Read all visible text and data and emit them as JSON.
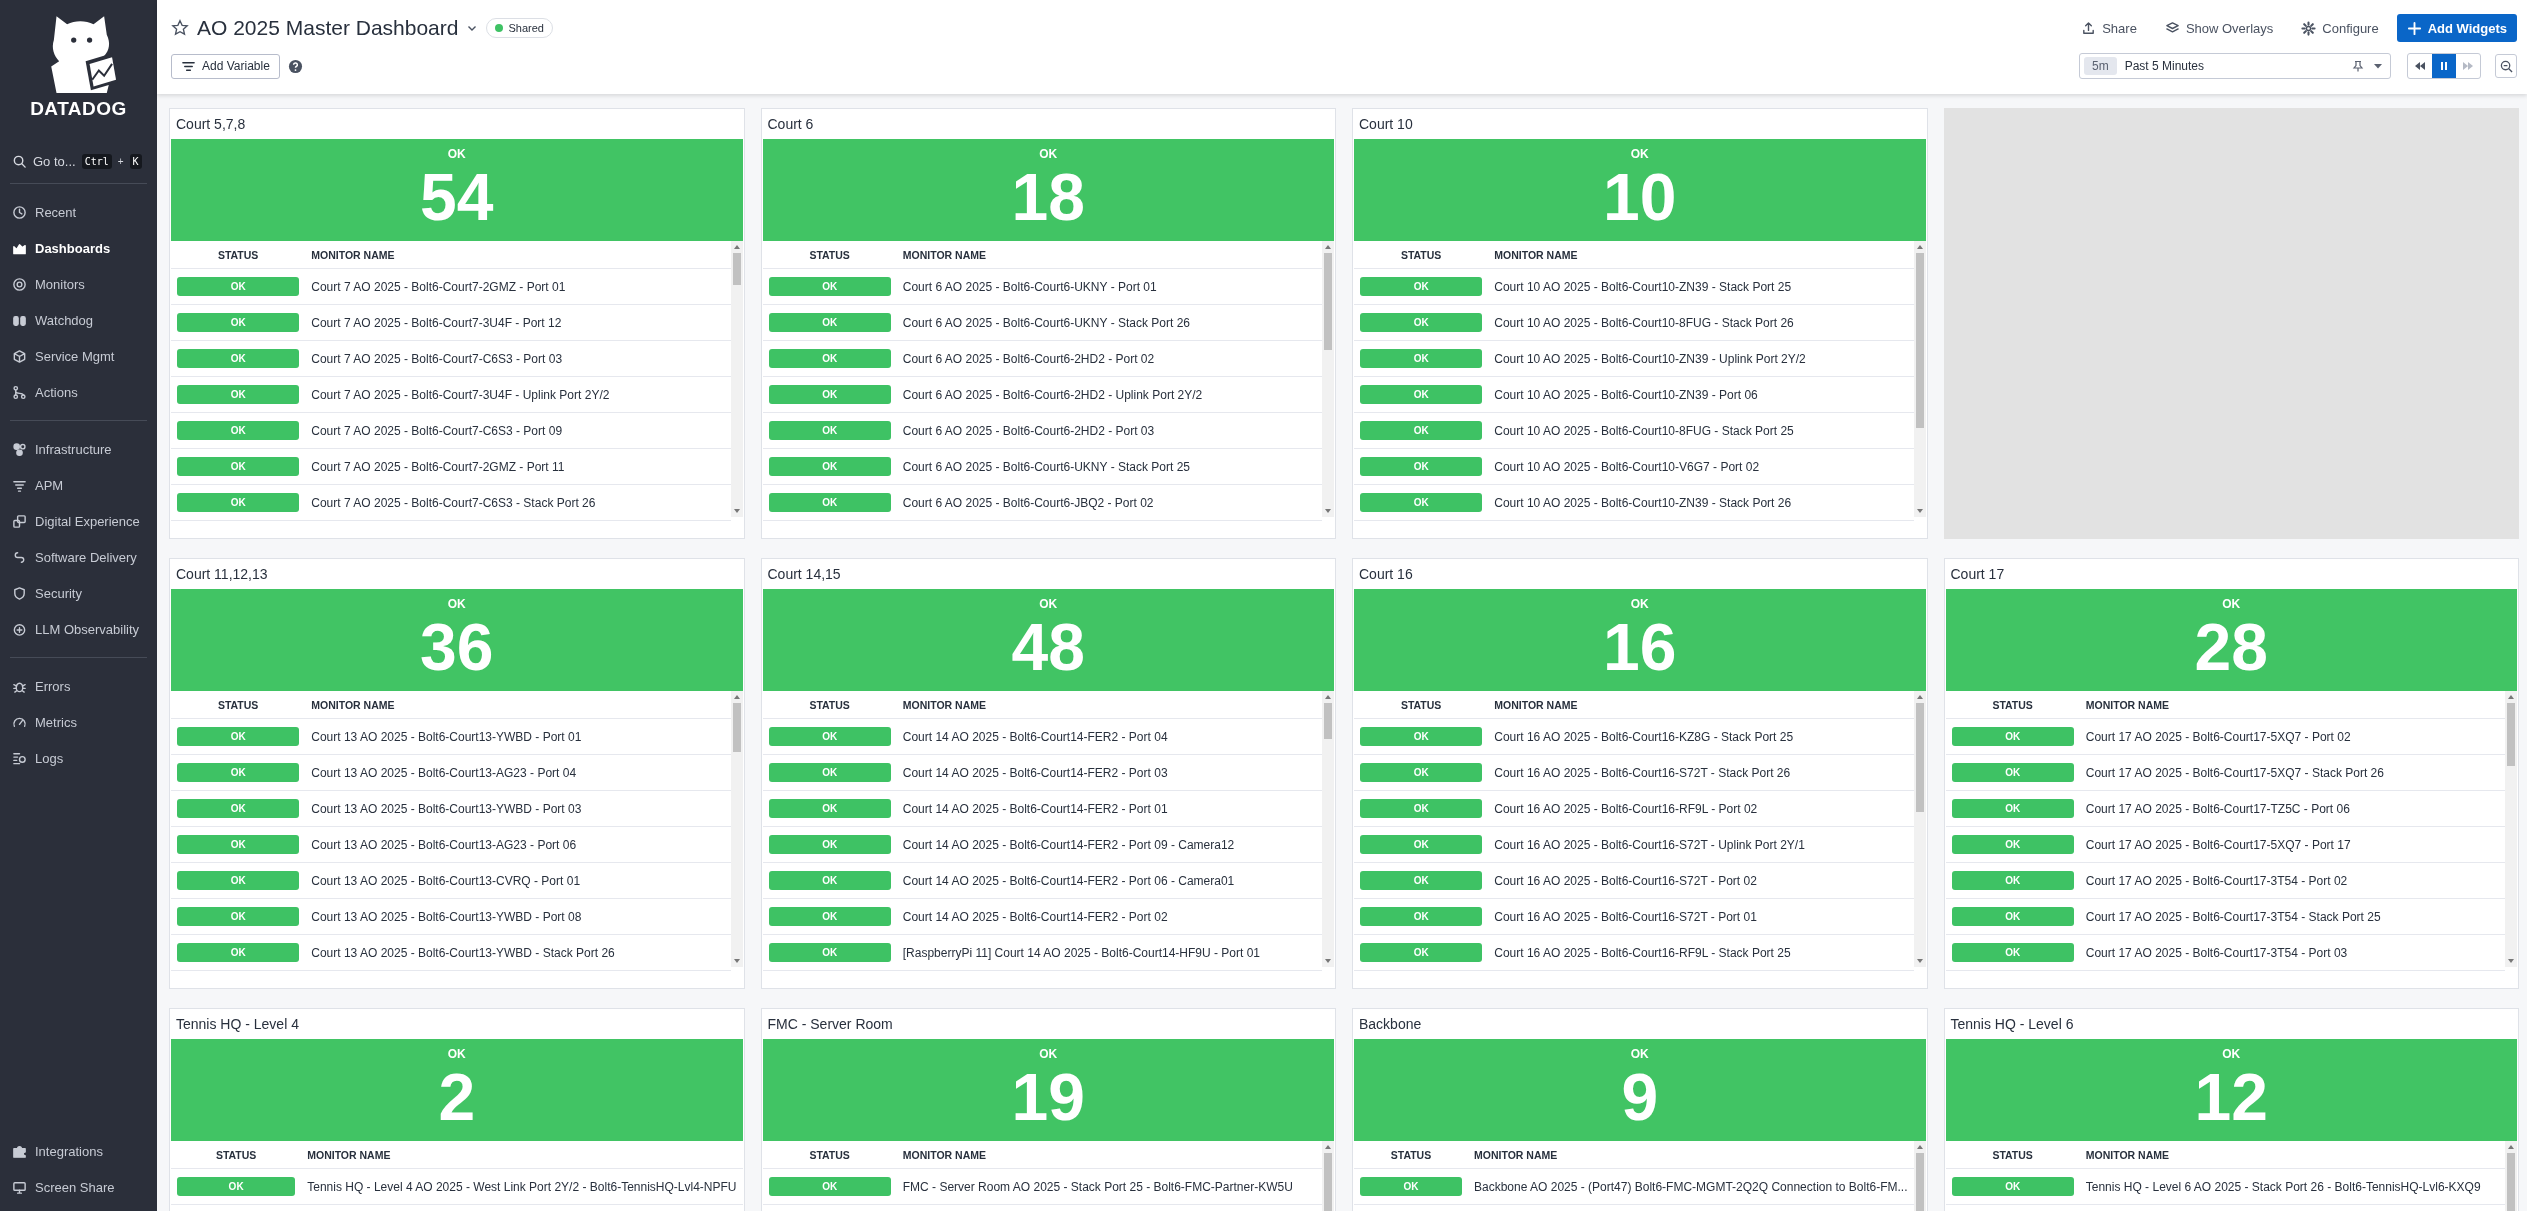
{
  "sidebar": {
    "logo_text": "DATADOG",
    "search": {
      "label": "Go to...",
      "keys": [
        "Ctrl",
        "+",
        "K"
      ]
    },
    "sections": [
      {
        "items": [
          {
            "label": "Recent",
            "selected": false
          },
          {
            "label": "Dashboards",
            "selected": true
          },
          {
            "label": "Monitors",
            "selected": false
          },
          {
            "label": "Watchdog",
            "selected": false
          },
          {
            "label": "Service Mgmt",
            "selected": false
          },
          {
            "label": "Actions",
            "selected": false
          }
        ]
      },
      {
        "items": [
          {
            "label": "Infrastructure",
            "selected": false
          },
          {
            "label": "APM",
            "selected": false
          },
          {
            "label": "Digital Experience",
            "selected": false
          },
          {
            "label": "Software Delivery",
            "selected": false
          },
          {
            "label": "Security",
            "selected": false
          },
          {
            "label": "LLM Observability",
            "selected": false
          }
        ]
      },
      {
        "items": [
          {
            "label": "Errors",
            "selected": false
          },
          {
            "label": "Metrics",
            "selected": false
          },
          {
            "label": "Logs",
            "selected": false
          }
        ]
      }
    ],
    "bottom_items": [
      {
        "label": "Integrations",
        "selected": false
      },
      {
        "label": "Screen Share",
        "selected": false
      }
    ]
  },
  "header": {
    "title": "AO 2025 Master Dashboard",
    "badge": "Shared",
    "add_variable": "Add Variable",
    "actions": [
      {
        "label": "Share",
        "kind": "plain"
      },
      {
        "label": "Show Overlays",
        "kind": "plain"
      },
      {
        "label": "Configure",
        "kind": "plain"
      },
      {
        "label": "Add Widgets",
        "kind": "primary"
      }
    ],
    "timeframe": {
      "short": "5m",
      "label": "Past 5 Minutes"
    }
  },
  "widgets": [
    {
      "kind": "monitor-summary",
      "title": "Court 5,7,8",
      "status": "OK",
      "count": "54",
      "scrollable": true,
      "columns": [
        "STATUS",
        "MONITOR NAME"
      ],
      "rows": [
        {
          "status": "OK",
          "name": "Court 7 AO 2025 - Bolt6-Court7-2GMZ - Port 01"
        },
        {
          "status": "OK",
          "name": "Court 7 AO 2025 - Bolt6-Court7-3U4F - Port 12"
        },
        {
          "status": "OK",
          "name": "Court 7 AO 2025 - Bolt6-Court7-C6S3 - Port 03"
        },
        {
          "status": "OK",
          "name": "Court 7 AO 2025 - Bolt6-Court7-3U4F - Uplink Port 2Y/2"
        },
        {
          "status": "OK",
          "name": "Court 7 AO 2025 - Bolt6-Court7-C6S3 - Port 09"
        },
        {
          "status": "OK",
          "name": "Court 7 AO 2025 - Bolt6-Court7-2GMZ - Port 11"
        },
        {
          "status": "OK",
          "name": "Court 7 AO 2025 - Bolt6-Court7-C6S3 - Stack Port 26"
        }
      ]
    },
    {
      "kind": "monitor-summary",
      "title": "Court 6",
      "status": "OK",
      "count": "18",
      "scrollable": true,
      "columns": [
        "STATUS",
        "MONITOR NAME"
      ],
      "rows": [
        {
          "status": "OK",
          "name": "Court 6 AO 2025 - Bolt6-Court6-UKNY - Port 01"
        },
        {
          "status": "OK",
          "name": "Court 6 AO 2025 - Bolt6-Court6-UKNY - Stack Port 26"
        },
        {
          "status": "OK",
          "name": "Court 6 AO 2025 - Bolt6-Court6-2HD2 - Port 02"
        },
        {
          "status": "OK",
          "name": "Court 6 AO 2025 - Bolt6-Court6-2HD2 - Uplink Port 2Y/2"
        },
        {
          "status": "OK",
          "name": "Court 6 AO 2025 - Bolt6-Court6-2HD2 - Port 03"
        },
        {
          "status": "OK",
          "name": "Court 6 AO 2025 - Bolt6-Court6-UKNY - Stack Port 25"
        },
        {
          "status": "OK",
          "name": "Court 6 AO 2025 - Bolt6-Court6-JBQ2 - Port 02"
        }
      ]
    },
    {
      "kind": "monitor-summary",
      "title": "Court 10",
      "status": "OK",
      "count": "10",
      "scrollable": true,
      "columns": [
        "STATUS",
        "MONITOR NAME"
      ],
      "rows": [
        {
          "status": "OK",
          "name": "Court 10 AO 2025 - Bolt6-Court10-ZN39 - Stack Port 25"
        },
        {
          "status": "OK",
          "name": "Court 10 AO 2025 - Bolt6-Court10-8FUG - Stack Port 26"
        },
        {
          "status": "OK",
          "name": "Court 10 AO 2025 - Bolt6-Court10-ZN39 - Uplink Port 2Y/2"
        },
        {
          "status": "OK",
          "name": "Court 10 AO 2025 - Bolt6-Court10-ZN39 - Port 06"
        },
        {
          "status": "OK",
          "name": "Court 10 AO 2025 - Bolt6-Court10-8FUG - Stack Port 25"
        },
        {
          "status": "OK",
          "name": "Court 10 AO 2025 - Bolt6-Court10-V6G7 - Port 02"
        },
        {
          "status": "OK",
          "name": "Court 10 AO 2025 - Bolt6-Court10-ZN39 - Stack Port 26"
        }
      ]
    },
    {
      "kind": "placeholder"
    },
    {
      "kind": "monitor-summary",
      "title": "Court 11,12,13",
      "status": "OK",
      "count": "36",
      "scrollable": true,
      "columns": [
        "STATUS",
        "MONITOR NAME"
      ],
      "rows": [
        {
          "status": "OK",
          "name": "Court 13 AO 2025 - Bolt6-Court13-YWBD - Port 01"
        },
        {
          "status": "OK",
          "name": "Court 13 AO 2025 - Bolt6-Court13-AG23 - Port 04"
        },
        {
          "status": "OK",
          "name": "Court 13 AO 2025 - Bolt6-Court13-YWBD - Port 03"
        },
        {
          "status": "OK",
          "name": "Court 13 AO 2025 - Bolt6-Court13-AG23 - Port 06"
        },
        {
          "status": "OK",
          "name": "Court 13 AO 2025 - Bolt6-Court13-CVRQ - Port 01"
        },
        {
          "status": "OK",
          "name": "Court 13 AO 2025 - Bolt6-Court13-YWBD - Port 08"
        },
        {
          "status": "OK",
          "name": "Court 13 AO 2025 - Bolt6-Court13-YWBD - Stack Port 26"
        }
      ]
    },
    {
      "kind": "monitor-summary",
      "title": "Court 14,15",
      "status": "OK",
      "count": "48",
      "scrollable": true,
      "columns": [
        "STATUS",
        "MONITOR NAME"
      ],
      "rows": [
        {
          "status": "OK",
          "name": "Court 14 AO 2025 - Bolt6-Court14-FER2 - Port 04"
        },
        {
          "status": "OK",
          "name": "Court 14 AO 2025 - Bolt6-Court14-FER2 - Port 03"
        },
        {
          "status": "OK",
          "name": "Court 14 AO 2025 - Bolt6-Court14-FER2 - Port 01"
        },
        {
          "status": "OK",
          "name": "Court 14 AO 2025 - Bolt6-Court14-FER2 - Port 09 - Camera12"
        },
        {
          "status": "OK",
          "name": "Court 14 AO 2025 - Bolt6-Court14-FER2 - Port 06 - Camera01"
        },
        {
          "status": "OK",
          "name": "Court 14 AO 2025 - Bolt6-Court14-FER2 - Port 02"
        },
        {
          "status": "OK",
          "name": "[RaspberryPi 11] Court 14 AO 2025 - Bolt6-Court14-HF9U - Port 01"
        }
      ]
    },
    {
      "kind": "monitor-summary",
      "title": "Court 16",
      "status": "OK",
      "count": "16",
      "scrollable": true,
      "columns": [
        "STATUS",
        "MONITOR NAME"
      ],
      "rows": [
        {
          "status": "OK",
          "name": "Court 16 AO 2025 - Bolt6-Court16-KZ8G - Stack Port 25"
        },
        {
          "status": "OK",
          "name": "Court 16 AO 2025 - Bolt6-Court16-S72T - Stack Port 26"
        },
        {
          "status": "OK",
          "name": "Court 16 AO 2025 - Bolt6-Court16-RF9L - Port 02"
        },
        {
          "status": "OK",
          "name": "Court 16 AO 2025 - Bolt6-Court16-S72T - Uplink Port 2Y/1"
        },
        {
          "status": "OK",
          "name": "Court 16 AO 2025 - Bolt6-Court16-S72T - Port 02"
        },
        {
          "status": "OK",
          "name": "Court 16 AO 2025 - Bolt6-Court16-S72T - Port 01"
        },
        {
          "status": "OK",
          "name": "Court 16 AO 2025 - Bolt6-Court16-RF9L - Stack Port 25"
        }
      ]
    },
    {
      "kind": "monitor-summary",
      "title": "Court 17",
      "status": "OK",
      "count": "28",
      "scrollable": true,
      "columns": [
        "STATUS",
        "MONITOR NAME"
      ],
      "rows": [
        {
          "status": "OK",
          "name": "Court 17 AO 2025 - Bolt6-Court17-5XQ7 - Port 02"
        },
        {
          "status": "OK",
          "name": "Court 17 AO 2025 - Bolt6-Court17-5XQ7 - Stack Port 26"
        },
        {
          "status": "OK",
          "name": "Court 17 AO 2025 - Bolt6-Court17-TZ5C - Port 06"
        },
        {
          "status": "OK",
          "name": "Court 17 AO 2025 - Bolt6-Court17-5XQ7 - Port 17"
        },
        {
          "status": "OK",
          "name": "Court 17 AO 2025 - Bolt6-Court17-3T54 - Port 02"
        },
        {
          "status": "OK",
          "name": "Court 17 AO 2025 - Bolt6-Court17-3T54 - Stack Port 25"
        },
        {
          "status": "OK",
          "name": "Court 17 AO 2025 - Bolt6-Court17-3T54 - Port 03"
        }
      ]
    },
    {
      "kind": "monitor-summary",
      "title": "Tennis HQ - Level 4",
      "status": "OK",
      "count": "2",
      "scrollable": false,
      "columns": [
        "STATUS",
        "MONITOR NAME"
      ],
      "rows": [
        {
          "status": "OK",
          "name": "Tennis HQ - Level 4 AO 2025 - West Link Port 2Y/2 - Bolt6-TennisHQ-Lvl4-NPFU"
        }
      ]
    },
    {
      "kind": "monitor-summary",
      "title": "FMC - Server Room",
      "status": "OK",
      "count": "19",
      "scrollable": true,
      "columns": [
        "STATUS",
        "MONITOR NAME"
      ],
      "rows": [
        {
          "status": "OK",
          "name": "FMC - Server Room AO 2025 - Stack Port 25 - Bolt6-FMC-Partner-KW5U"
        }
      ]
    },
    {
      "kind": "monitor-summary",
      "title": "Backbone",
      "status": "OK",
      "count": "9",
      "scrollable": true,
      "columns": [
        "STATUS",
        "MONITOR NAME"
      ],
      "rows": [
        {
          "status": "OK",
          "name": "Backbone AO 2025 - (Port47) Bolt6-FMC-MGMT-2Q2Q Connection to Bolt6-FM..."
        }
      ]
    },
    {
      "kind": "monitor-summary",
      "title": "Tennis HQ - Level 6",
      "status": "OK",
      "count": "12",
      "scrollable": true,
      "columns": [
        "STATUS",
        "MONITOR NAME"
      ],
      "rows": [
        {
          "status": "OK",
          "name": "Tennis HQ - Level 6 AO 2025 - Stack Port 26 - Bolt6-TennisHQ-Lvl6-KXQ9"
        }
      ]
    }
  ]
}
